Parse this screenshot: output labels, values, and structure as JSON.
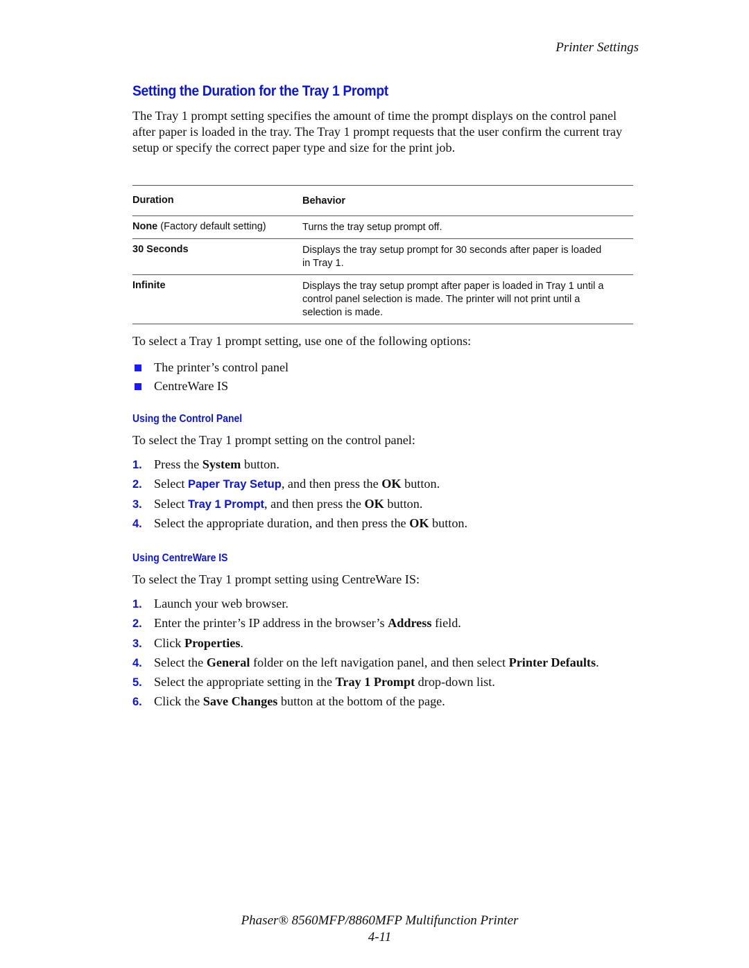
{
  "header": {
    "running_title": "Printer Settings"
  },
  "section": {
    "title": "Setting the Duration for the Tray 1 Prompt",
    "intro": "The Tray 1 prompt setting specifies the amount of time the prompt displays on the control panel after paper is loaded in the tray. The Tray 1 prompt requests that the user confirm the current tray setup or specify the correct paper type and size for the print job."
  },
  "table": {
    "columns": [
      "Duration",
      "Behavior"
    ],
    "rows": [
      {
        "duration": "None",
        "duration_note": " (Factory default setting)",
        "behavior": "Turns the tray setup prompt off."
      },
      {
        "duration": "30 Seconds",
        "duration_note": "",
        "behavior": "Displays the tray setup prompt for 30 seconds after paper is loaded in Tray 1."
      },
      {
        "duration": "Infinite",
        "duration_note": "",
        "behavior": "Displays the tray setup prompt after paper is loaded in Tray 1 until a control panel selection is made. The printer will not print until a selection is made."
      }
    ]
  },
  "options": {
    "lead": "To select a Tray 1 prompt setting, use one of the following options:",
    "items": [
      "The printer’s control panel",
      "CentreWare IS"
    ]
  },
  "control_panel": {
    "heading": "Using the Control Panel",
    "lead": "To select the Tray 1 prompt setting on the control panel:",
    "steps": [
      {
        "num": "1.",
        "parts": [
          [
            "t",
            "Press the "
          ],
          [
            "b",
            "System"
          ],
          [
            "t",
            " button."
          ]
        ]
      },
      {
        "num": "2.",
        "parts": [
          [
            "t",
            "Select "
          ],
          [
            "u",
            "Paper Tray Setup"
          ],
          [
            "t",
            ", and then press the "
          ],
          [
            "b",
            "OK"
          ],
          [
            "t",
            " button."
          ]
        ]
      },
      {
        "num": "3.",
        "parts": [
          [
            "t",
            "Select "
          ],
          [
            "u",
            "Tray 1 Prompt"
          ],
          [
            "t",
            ", and then press the "
          ],
          [
            "b",
            "OK"
          ],
          [
            "t",
            " button."
          ]
        ]
      },
      {
        "num": "4.",
        "parts": [
          [
            "t",
            "Select the appropriate duration, and then press the "
          ],
          [
            "b",
            "OK"
          ],
          [
            "t",
            " button."
          ]
        ]
      }
    ]
  },
  "centreware": {
    "heading": "Using CentreWare IS",
    "lead": "To select the Tray 1 prompt setting using CentreWare IS:",
    "steps": [
      {
        "num": "1.",
        "parts": [
          [
            "t",
            "Launch your web browser."
          ]
        ]
      },
      {
        "num": "2.",
        "parts": [
          [
            "t",
            "Enter the printer’s IP address in the browser’s "
          ],
          [
            "b",
            "Address"
          ],
          [
            "t",
            " field."
          ]
        ]
      },
      {
        "num": "3.",
        "parts": [
          [
            "t",
            "Click "
          ],
          [
            "b",
            "Properties"
          ],
          [
            "t",
            "."
          ]
        ]
      },
      {
        "num": "4.",
        "parts": [
          [
            "t",
            "Select the "
          ],
          [
            "b",
            "General"
          ],
          [
            "t",
            " folder on the left navigation panel, and then select "
          ],
          [
            "b",
            "Printer Defaults"
          ],
          [
            "t",
            "."
          ]
        ]
      },
      {
        "num": "5.",
        "parts": [
          [
            "t",
            "Select the appropriate setting in the "
          ],
          [
            "b",
            "Tray 1 Prompt"
          ],
          [
            "t",
            " drop-down list."
          ]
        ]
      },
      {
        "num": "6.",
        "parts": [
          [
            "t",
            "Click the "
          ],
          [
            "b",
            "Save Changes"
          ],
          [
            "t",
            " button at the bottom of the page."
          ]
        ]
      }
    ]
  },
  "footer": {
    "product": "Phaser® 8560MFP/8860MFP Multifunction Printer",
    "page_number": "4-11"
  },
  "colors": {
    "accent_blue": "#0a14e6",
    "bullet_blue": "#1a1aff",
    "rule_gray": "#555555"
  }
}
